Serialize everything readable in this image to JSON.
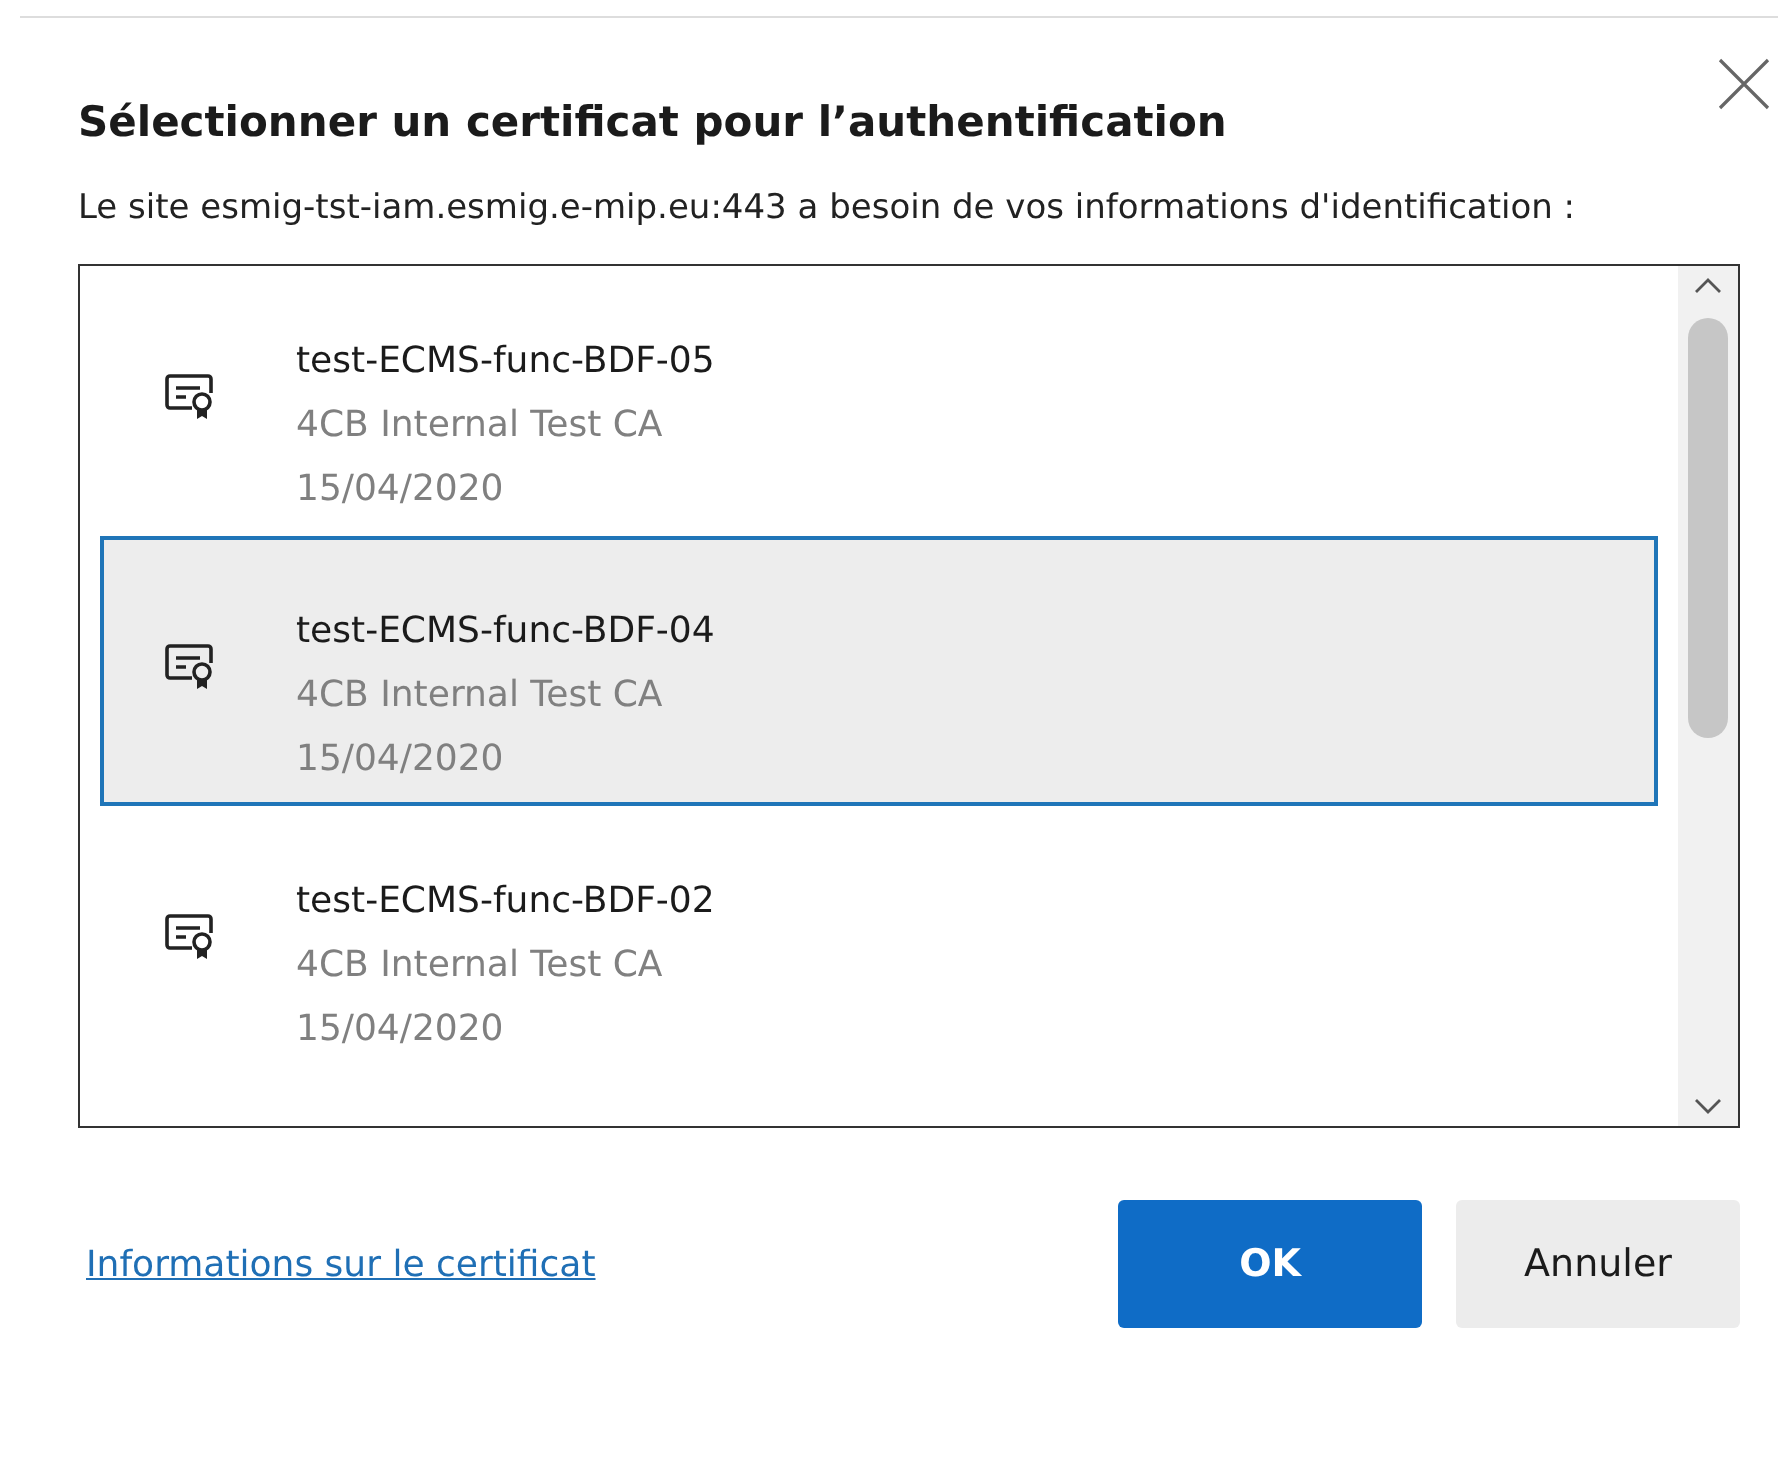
{
  "dialog": {
    "title": "Sélectionner un certificat pour l’authentification",
    "description": "Le site esmig-tst-iam.esmig.e-mip.eu:443 a besoin de vos informations d'identification :"
  },
  "certificates": [
    {
      "name": "test-ECMS-func-BDF-05",
      "issuer": "4CB Internal Test CA",
      "date": "15/04/2020",
      "selected": false
    },
    {
      "name": "test-ECMS-func-BDF-04",
      "issuer": "4CB Internal Test CA",
      "date": "15/04/2020",
      "selected": true
    },
    {
      "name": "test-ECMS-func-BDF-02",
      "issuer": "4CB Internal Test CA",
      "date": "15/04/2020",
      "selected": false
    }
  ],
  "footer": {
    "link": "Informations sur le certificat",
    "ok_button": "OK",
    "cancel_button": "Annuler"
  }
}
